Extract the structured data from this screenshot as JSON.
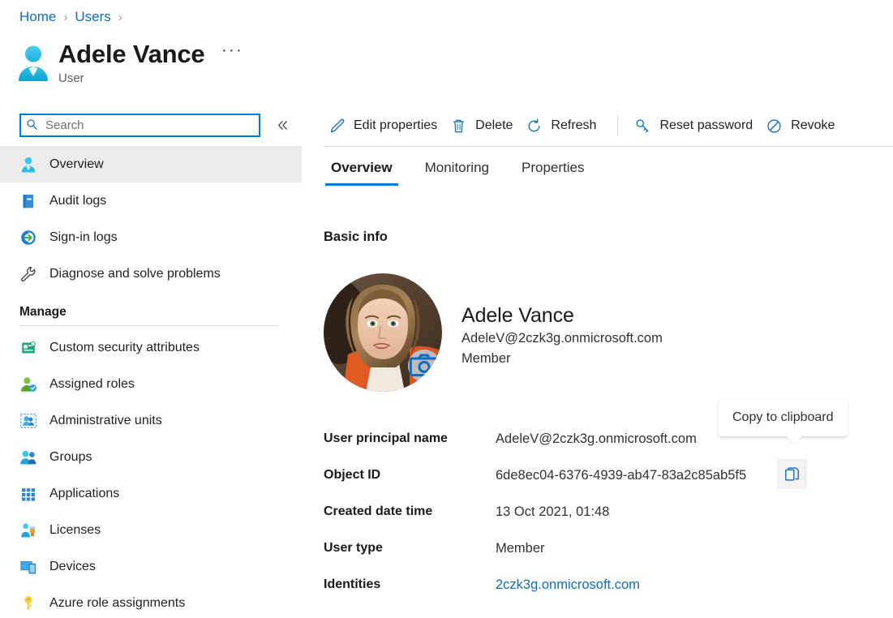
{
  "breadcrumb": {
    "items": [
      {
        "label": "Home"
      },
      {
        "label": "Users"
      }
    ],
    "separator": "›"
  },
  "header": {
    "icon": "user-avatar-icon",
    "title": "Adele Vance",
    "subtitle": "User",
    "more_label": "···"
  },
  "sidebar": {
    "search": {
      "icon": "search-icon",
      "placeholder": "Search",
      "value": ""
    },
    "collapse": {
      "icon": "chevron-double-left-icon",
      "label": "«"
    },
    "items": [
      {
        "label": "Overview",
        "icon": "user-icon",
        "selected": true
      },
      {
        "label": "Audit logs",
        "icon": "book-icon",
        "selected": false
      },
      {
        "label": "Sign-in logs",
        "icon": "sign-in-icon",
        "selected": false
      },
      {
        "label": "Diagnose and solve problems",
        "icon": "wrench-icon",
        "selected": false
      }
    ],
    "group": {
      "header": "Manage",
      "items": [
        {
          "label": "Custom security attributes",
          "icon": "attribute-icon"
        },
        {
          "label": "Assigned roles",
          "icon": "assigned-roles-icon"
        },
        {
          "label": "Administrative units",
          "icon": "administrative-units-icon"
        },
        {
          "label": "Groups",
          "icon": "groups-icon"
        },
        {
          "label": "Applications",
          "icon": "applications-grid-icon"
        },
        {
          "label": "Licenses",
          "icon": "licenses-icon"
        },
        {
          "label": "Devices",
          "icon": "devices-icon"
        },
        {
          "label": "Azure role assignments",
          "icon": "key-icon"
        }
      ]
    }
  },
  "toolbar": {
    "buttons": [
      {
        "label": "Edit properties",
        "icon": "pencil-icon"
      },
      {
        "label": "Delete",
        "icon": "trash-icon"
      },
      {
        "label": "Refresh",
        "icon": "refresh-icon"
      },
      {
        "label": "Reset password",
        "icon": "key-icon"
      },
      {
        "label": "Revoke",
        "icon": "revoke-icon"
      }
    ]
  },
  "tabs": [
    {
      "label": "Overview",
      "active": true
    },
    {
      "label": "Monitoring",
      "active": false
    },
    {
      "label": "Properties",
      "active": false
    }
  ],
  "main": {
    "section_title": "Basic info",
    "identity": {
      "name": "Adele Vance",
      "upn": "AdeleV@2czk3g.onmicrosoft.com",
      "user_type": "Member",
      "camera_badge_icon": "camera-icon"
    },
    "properties": [
      {
        "key": "User principal name",
        "value": "AdeleV@2czk3g.onmicrosoft.com",
        "link": false,
        "copy": false
      },
      {
        "key": "Object ID",
        "value": "6de8ec04-6376-4939-ab47-83a2c85ab5f5",
        "link": false,
        "copy": true
      },
      {
        "key": "Created date time",
        "value": "13 Oct 2021, 01:48",
        "link": false,
        "copy": false
      },
      {
        "key": "User type",
        "value": "Member",
        "link": false,
        "copy": false
      },
      {
        "key": "Identities",
        "value": "2czk3g.onmicrosoft.com",
        "link": true,
        "copy": false
      }
    ],
    "copy_tooltip": "Copy to clipboard",
    "copy_icon": "copy-icon"
  },
  "colors": {
    "accent": "#0078d4",
    "link": "#0f6cbd",
    "selected_nav_bg": "#ebebeb",
    "divider": "#e1dfdd",
    "text": "#201f1e"
  }
}
